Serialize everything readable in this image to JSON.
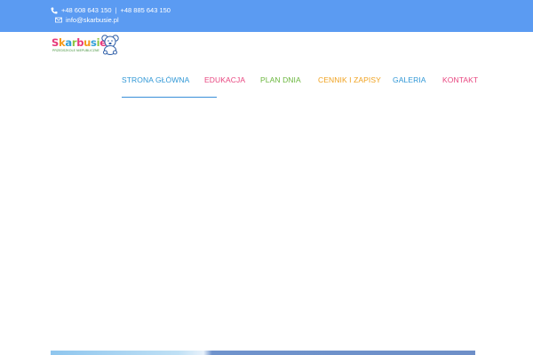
{
  "topbar": {
    "phone1": "+48 608 643 150",
    "separator": "|",
    "phone2": "+48 885 643 150",
    "email": "info@skarbusie.pl",
    "background": "#5b9bf2"
  },
  "logo": {
    "letters": [
      "S",
      "k",
      "a",
      "r",
      "b",
      "u",
      "s",
      "i",
      "e"
    ],
    "letter_colors": [
      "#e8387a",
      "#f39a1c",
      "#2f9fd8",
      "#8cc43f",
      "#e8387a",
      "#f39a1c",
      "#2f9fd8",
      "#8cc43f",
      "#e8387a"
    ],
    "tagline": "PRZEDSZKOLE NIEPUBLICZNE",
    "icon": "teddy-bear-icon"
  },
  "nav": {
    "items": [
      {
        "label": "STRONA GŁÓWNA",
        "color": "#2f97d6",
        "active": true
      },
      {
        "label": "EDUKACJA",
        "color": "#e8457f"
      },
      {
        "label": "PLAN DNIA",
        "color": "#6ab63d"
      },
      {
        "label": "CENNIK I ZAPISY",
        "color": "#f0a21f"
      },
      {
        "label": "GALERIA",
        "color": "#2f97d6"
      },
      {
        "label": "KONTAKT",
        "color": "#e8457f"
      }
    ]
  }
}
